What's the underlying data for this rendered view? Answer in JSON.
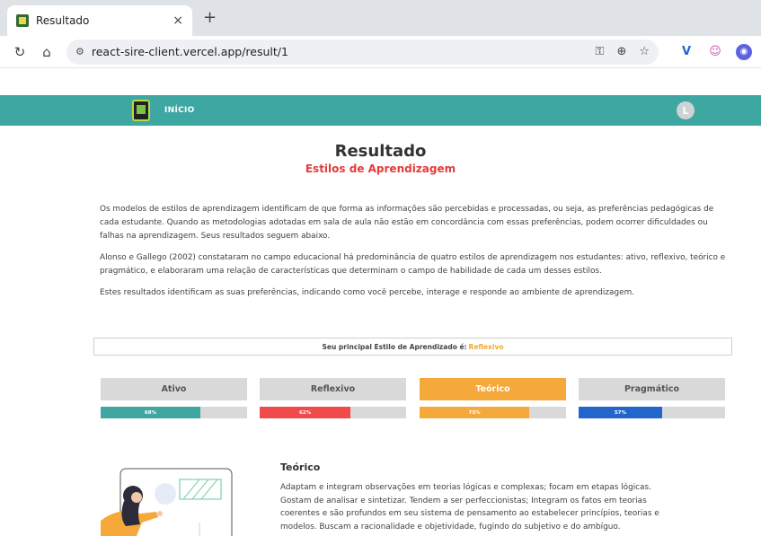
{
  "browser": {
    "tab_title": "Resultado",
    "tab_close": "×",
    "new_tab": "+",
    "url": "react-sire-client.vercel.app/result/1"
  },
  "header": {
    "nav_inicio": "INÍCIO",
    "avatar_letter": "L"
  },
  "page": {
    "title": "Resultado",
    "subtitle": "Estilos de Aprendizagem",
    "paragraphs": [
      "Os modelos de estilos de aprendizagem identificam de que forma as informações são percebidas e processadas, ou seja, as preferências pedagógicas de cada estudante. Quando as metodologias adotadas em sala de aula não estão em concordância com essas preferências, podem ocorrer dificuldades ou falhas na aprendizagem. Seus resultados seguem abaixo.",
      "Alonso e Gallego (2002) constataram no campo educacional há predominância de quatro estilos de aprendizagem nos estudantes: ativo, reflexivo, teórico e pragmático, e elaboraram uma relação de características que determinam o campo de habilidade de cada um desses estilos.",
      "Estes resultados identificam as suas preferências, indicando como você percebe, interage e responde ao ambiente de aprendizagem."
    ],
    "principal_label": "Seu principal Estilo de Aprendizado é:",
    "principal_value": "Reflexivo"
  },
  "styles": [
    {
      "label": "Ativo",
      "percent": 68,
      "percent_label": "68%",
      "color": "#3fa7a2",
      "active": false
    },
    {
      "label": "Reflexivo",
      "percent": 62,
      "percent_label": "62%",
      "color": "#f04a4a",
      "active": false
    },
    {
      "label": "Teórico",
      "percent": 75,
      "percent_label": "75%",
      "color": "#f6a93b",
      "active": true
    },
    {
      "label": "Pragmático",
      "percent": 57,
      "percent_label": "57%",
      "color": "#2266cc",
      "active": false
    }
  ],
  "detail": {
    "title": "Teórico",
    "text": "Adaptam e integram observações em teorias lógicas e complexas; focam em etapas lógicas. Gostam de analisar e sintetizar. Tendem a ser perfeccionistas; Integram os fatos em teorias coerentes e são profundos em seu sistema de pensamento ao estabelecer princípios, teorias e modelos. Buscam a racionalidade e objetividade, fugindo do subjetivo e do ambíguo."
  }
}
